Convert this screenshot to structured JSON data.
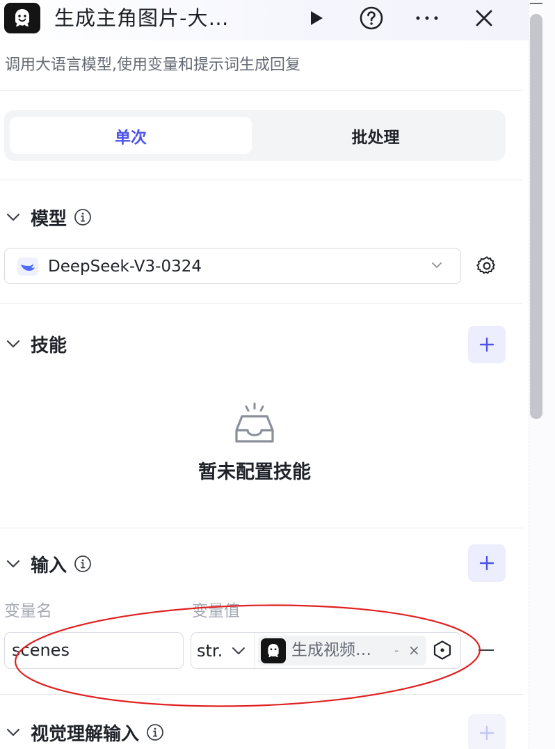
{
  "header": {
    "title": "生成主角图片-大…",
    "run_icon": "play-icon",
    "help_icon": "help-circle-icon",
    "more_icon": "more-icon",
    "close_icon": "close-icon"
  },
  "description": "调用大语言模型,使用变量和提示词生成回复",
  "tabs": [
    {
      "label": "单次",
      "active": true
    },
    {
      "label": "批处理",
      "active": false
    }
  ],
  "model_section": {
    "title": "模型",
    "selected_model": "DeepSeek-V3-0324"
  },
  "skills_section": {
    "title": "技能",
    "empty_text": "暂未配置技能"
  },
  "input_section": {
    "title": "输入",
    "col_name": "变量名",
    "col_value": "变量值",
    "rows": [
      {
        "name": "scenes",
        "type": "str.",
        "ref": "生成视频…",
        "ref_dot": "-",
        "ref_close": "×"
      }
    ]
  },
  "vision_section": {
    "title": "视觉理解输入"
  },
  "colors": {
    "accent": "#4d53e8",
    "annotation": "#e02020",
    "icon_bg": "#141414"
  }
}
